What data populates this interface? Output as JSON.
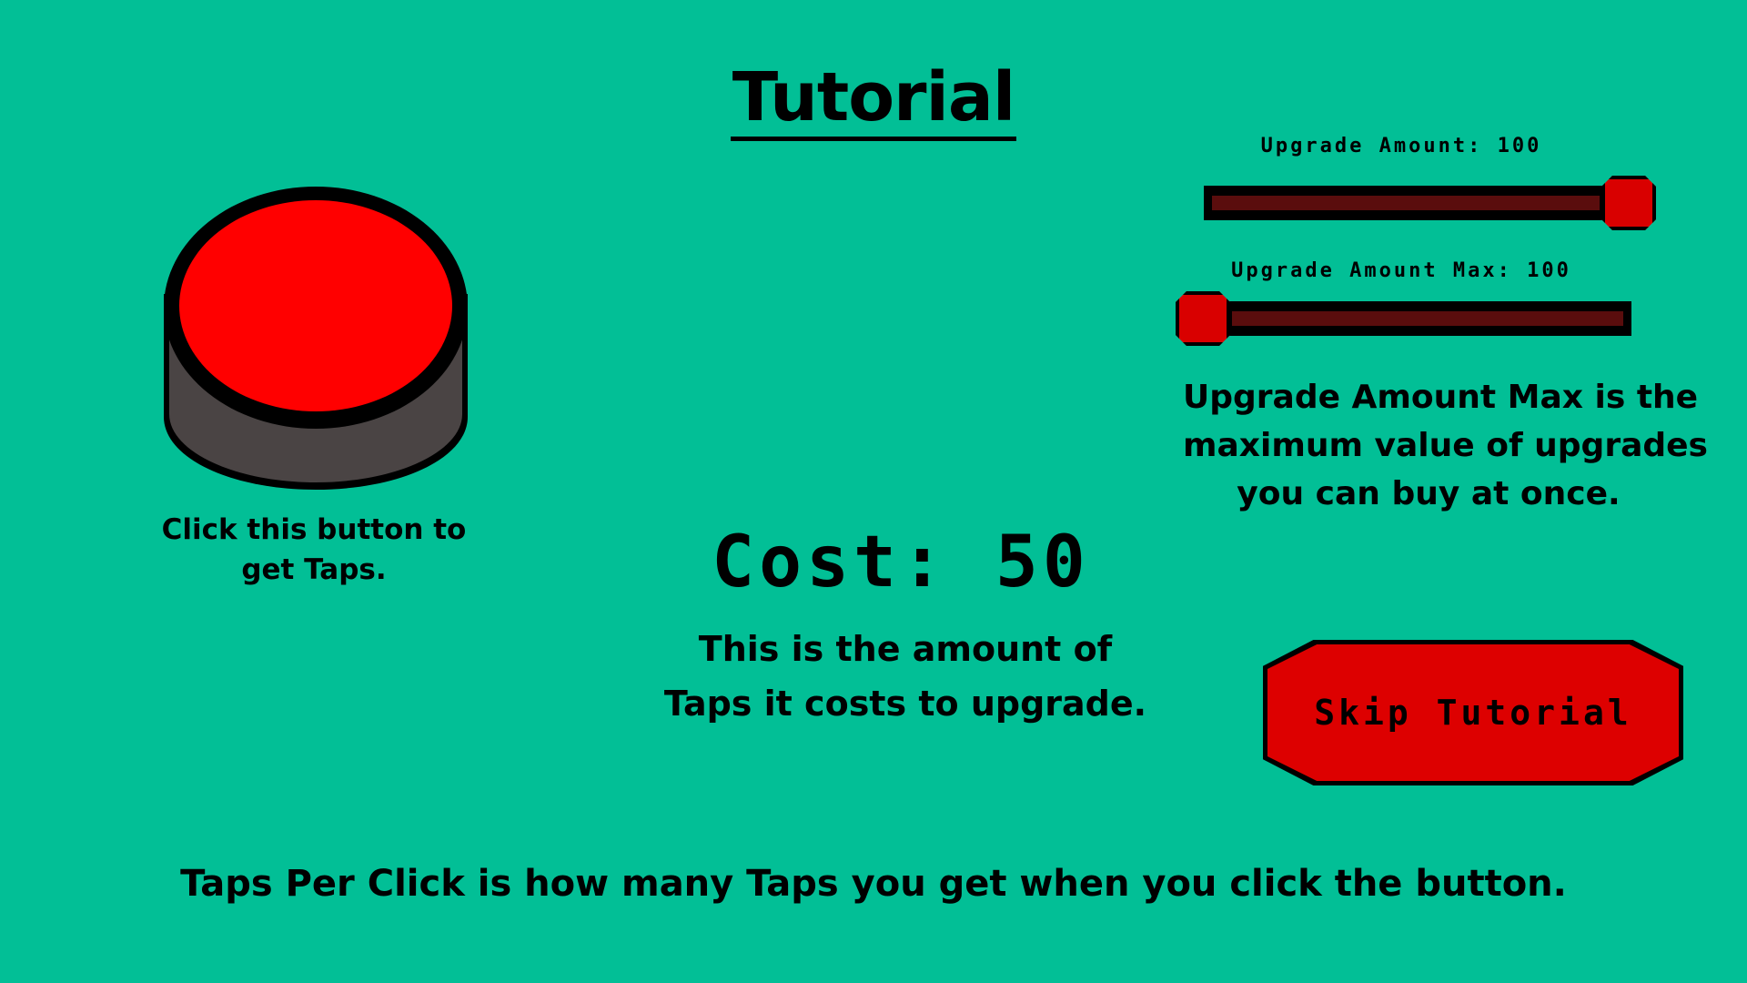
{
  "title": "Tutorial",
  "tap_button": {
    "icon": "big-red-button-icon",
    "caption_line1": "Click this button to",
    "caption_line2": "get Taps."
  },
  "cost": {
    "text": "Cost: 50",
    "caption_line1": "This is the amount of",
    "caption_line2": "Taps it costs to upgrade."
  },
  "upgrade_amount": {
    "label": "Upgrade Amount: 100",
    "level": 1.0
  },
  "upgrade_amount_max": {
    "label": "Upgrade Amount Max: 100",
    "level": 0.0,
    "caption_line1": "Upgrade Amount Max is the",
    "caption_line2": "maximum value of upgrades",
    "caption_line3": "you can buy at once."
  },
  "skip_button": {
    "label": "Skip Tutorial"
  },
  "bottom_caption": "Taps Per Click is how many Taps you get when you click the button.",
  "colors": {
    "background": "#02bf96",
    "button_red": "#ff0000",
    "button_base": "#4a4444",
    "slider_fill": "#5a0d0d",
    "knob_red": "#d90000"
  }
}
